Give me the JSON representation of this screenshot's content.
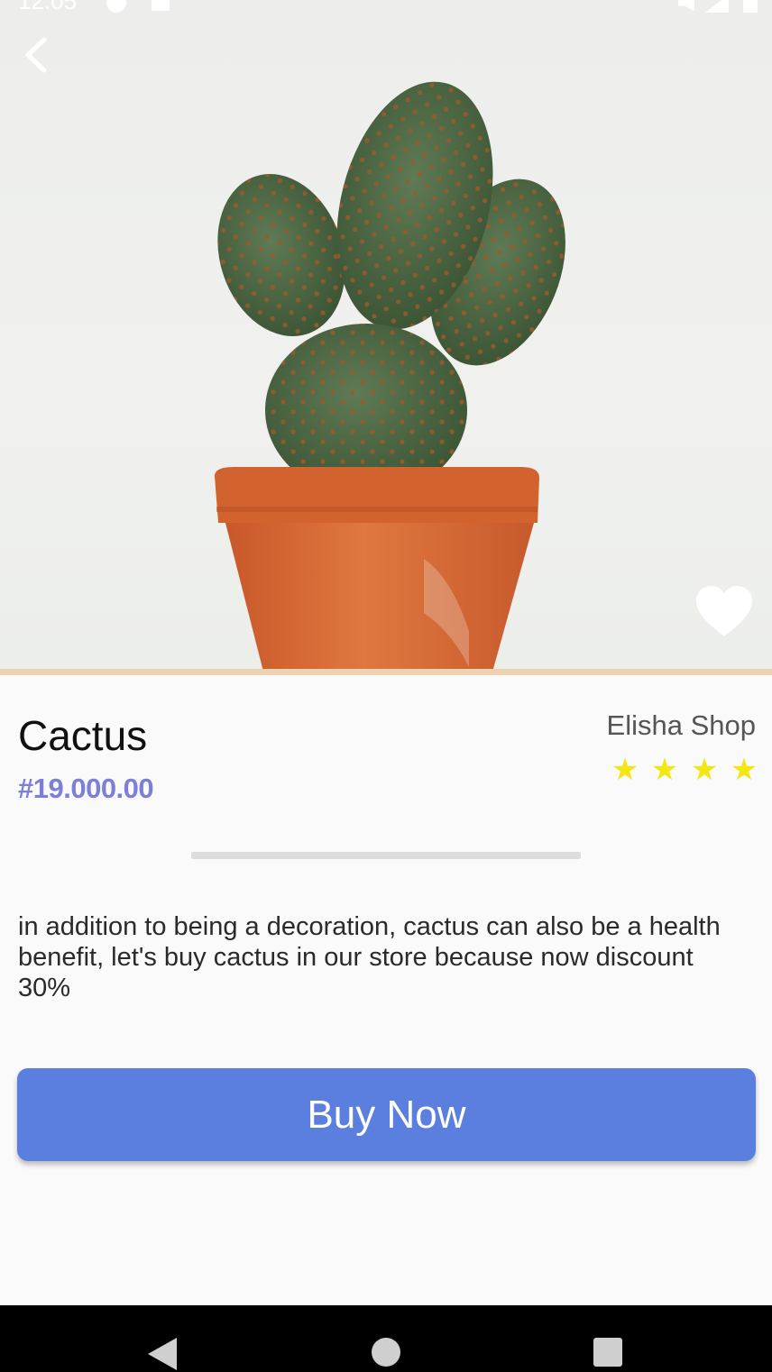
{
  "status_bar": {
    "time": "12:05"
  },
  "hero": {
    "back_icon": "chevron-left-icon",
    "favorite_icon": "heart-icon",
    "image": "potted-cactus-photo"
  },
  "product": {
    "name": "Cactus",
    "price": "#19.000.00",
    "shop": "Elisha Shop",
    "rating_stars": 4,
    "description": "in addition to being a decoration, cactus can also be a health benefit, let's buy cactus in our store because now discount 30%"
  },
  "actions": {
    "buy_label": "Buy Now"
  },
  "colors": {
    "accent": "#5b7fdf",
    "price": "#7b7fd8",
    "star": "#f3e613"
  },
  "nav": {
    "back_icon": "triangle-back-icon",
    "home_icon": "circle-home-icon",
    "recent_icon": "square-recents-icon"
  }
}
